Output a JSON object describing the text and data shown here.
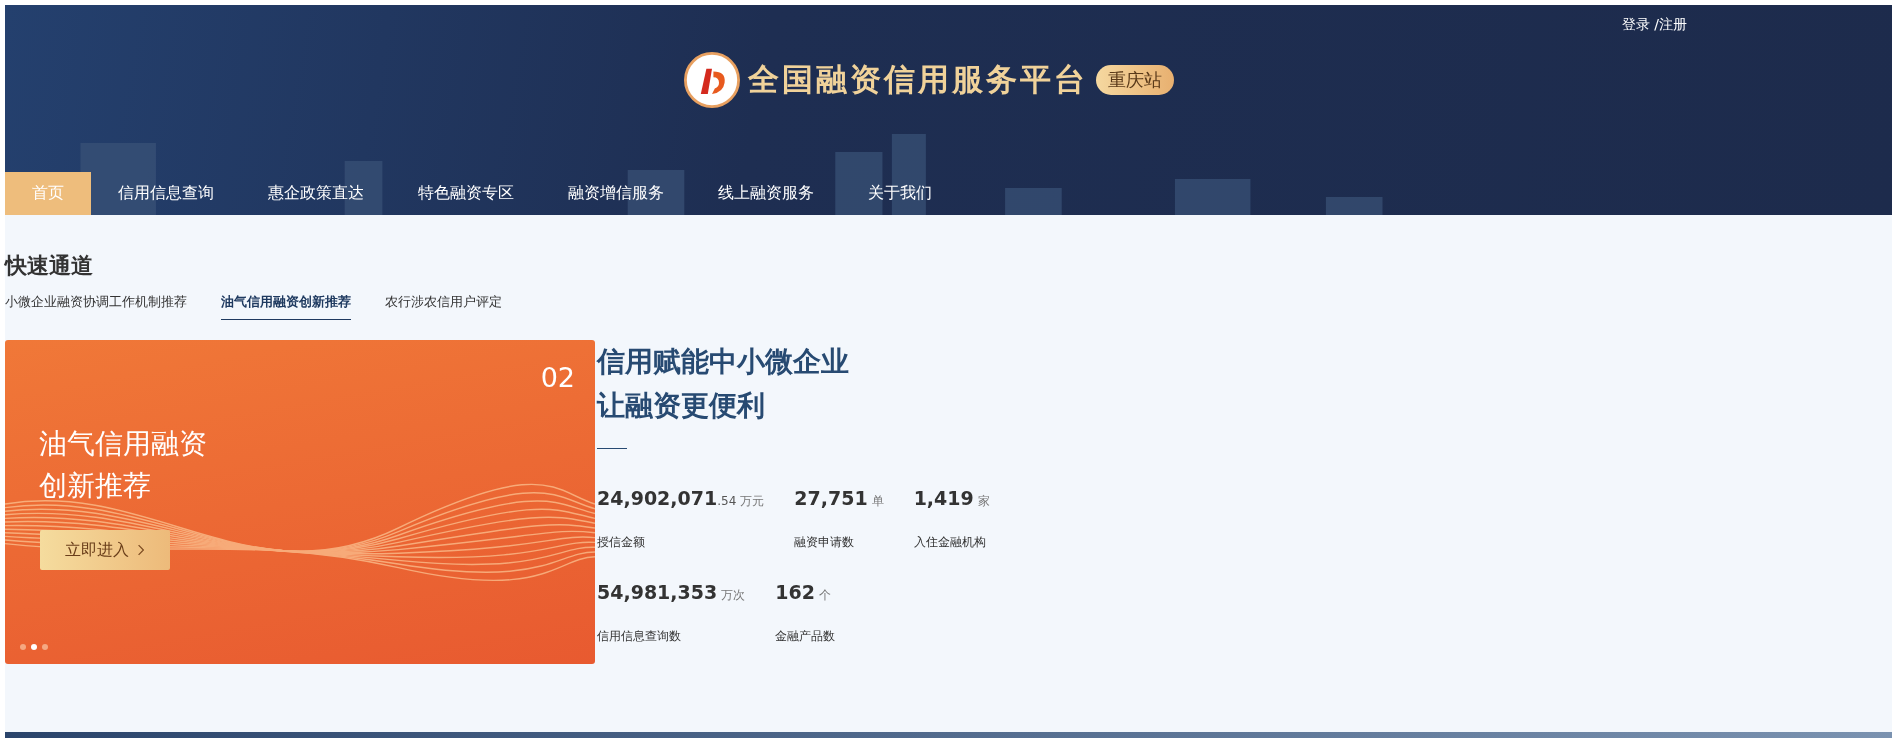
{
  "header": {
    "login": "登录 /注册",
    "site_title": "全国融资信用服务平台",
    "station_badge": "重庆站"
  },
  "nav": [
    {
      "label": "首页",
      "selected": true
    },
    {
      "label": "信用信息查询",
      "selected": false
    },
    {
      "label": "惠企政策直达",
      "selected": false
    },
    {
      "label": "特色融资专区",
      "selected": false
    },
    {
      "label": "融资增信服务",
      "selected": false
    },
    {
      "label": "线上融资服务",
      "selected": false
    },
    {
      "label": "关于我们",
      "selected": false
    }
  ],
  "quick_access": {
    "title": "快速通道",
    "tabs": [
      {
        "label": "小微企业融资协调工作机制推荐",
        "selected": false
      },
      {
        "label": "油气信用融资创新推荐",
        "selected": true
      },
      {
        "label": "农行涉农信用户评定",
        "selected": false
      }
    ]
  },
  "banner": {
    "number": "02",
    "title_lines": [
      "油气信用融资",
      "创新推荐"
    ],
    "button": "立即进入",
    "dots": [
      {
        "selected": false
      },
      {
        "selected": true
      },
      {
        "selected": false
      }
    ]
  },
  "intro": {
    "headline_lines": [
      "信用赋能中小微企业",
      "让融资更便利"
    ]
  },
  "stats": [
    [
      {
        "value": "24,902,071",
        "decimal": ".54",
        "unit": "万元",
        "label": "授信金额"
      },
      {
        "value": "27,751",
        "unit": "单",
        "label": "融资申请数"
      },
      {
        "value": "1,419",
        "unit": "家",
        "label": "入住金融机构"
      }
    ],
    [
      {
        "value": "54,981,353",
        "unit": "万次",
        "label": "信用信息查询数"
      },
      {
        "value": "162",
        "unit": "个",
        "label": "金融产品数"
      }
    ]
  ]
}
